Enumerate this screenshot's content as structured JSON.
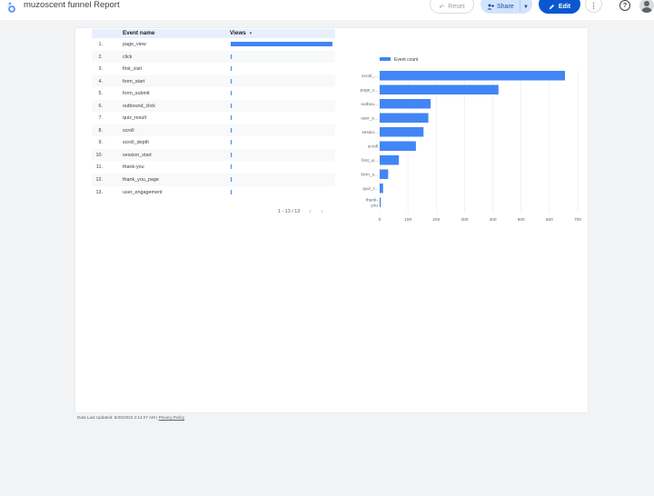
{
  "header": {
    "title": "muzoscent funnel Report",
    "reset_label": "Reset",
    "share_label": "Share",
    "edit_label": "Edit"
  },
  "colors": {
    "accent": "#0b57d0",
    "bar": "#4285f4",
    "header_row": "#e8f0fe"
  },
  "table": {
    "columns": [
      "Event name",
      "Views"
    ],
    "sort_indicator": "▼",
    "rows": [
      {
        "index": "1.",
        "name": "page_view",
        "views_fraction": 1.0
      },
      {
        "index": "2.",
        "name": "click",
        "views_fraction": 0.01
      },
      {
        "index": "3.",
        "name": "first_visit",
        "views_fraction": 0.01
      },
      {
        "index": "4.",
        "name": "form_start",
        "views_fraction": 0.01
      },
      {
        "index": "5.",
        "name": "form_submit",
        "views_fraction": 0.01
      },
      {
        "index": "6.",
        "name": "outbound_click",
        "views_fraction": 0.01
      },
      {
        "index": "7.",
        "name": "quiz_result",
        "views_fraction": 0.01
      },
      {
        "index": "8.",
        "name": "scroll",
        "views_fraction": 0.01
      },
      {
        "index": "9.",
        "name": "scroll_depth",
        "views_fraction": 0.01
      },
      {
        "index": "10.",
        "name": "session_start",
        "views_fraction": 0.01
      },
      {
        "index": "11.",
        "name": "thank-you",
        "views_fraction": 0.01
      },
      {
        "index": "12.",
        "name": "thank_you_page",
        "views_fraction": 0.01
      },
      {
        "index": "13.",
        "name": "user_engagement",
        "views_fraction": 0.01
      }
    ],
    "pagination": "1 - 13 / 13"
  },
  "chart_data": {
    "type": "bar",
    "orientation": "horizontal",
    "categories": [
      "scroll_...",
      "page_v...",
      "outbou...",
      "user_e...",
      "sessio...",
      "scroll",
      "first_vi...",
      "form_s...",
      "quiz_r...",
      "thank-you"
    ],
    "series": [
      {
        "name": "Event count",
        "values": [
          655,
          420,
          180,
          172,
          155,
          128,
          68,
          30,
          12,
          4
        ]
      }
    ],
    "xlim": [
      0,
      700
    ],
    "xticks": [
      0,
      100,
      200,
      300,
      400,
      500,
      600,
      700
    ],
    "grid": true,
    "legend": "top-left"
  },
  "footer": {
    "updated_text": "Data Last Updated: 8/28/2023 2:14:27 AM",
    "separator": " | ",
    "privacy_label": "Privacy Policy"
  }
}
